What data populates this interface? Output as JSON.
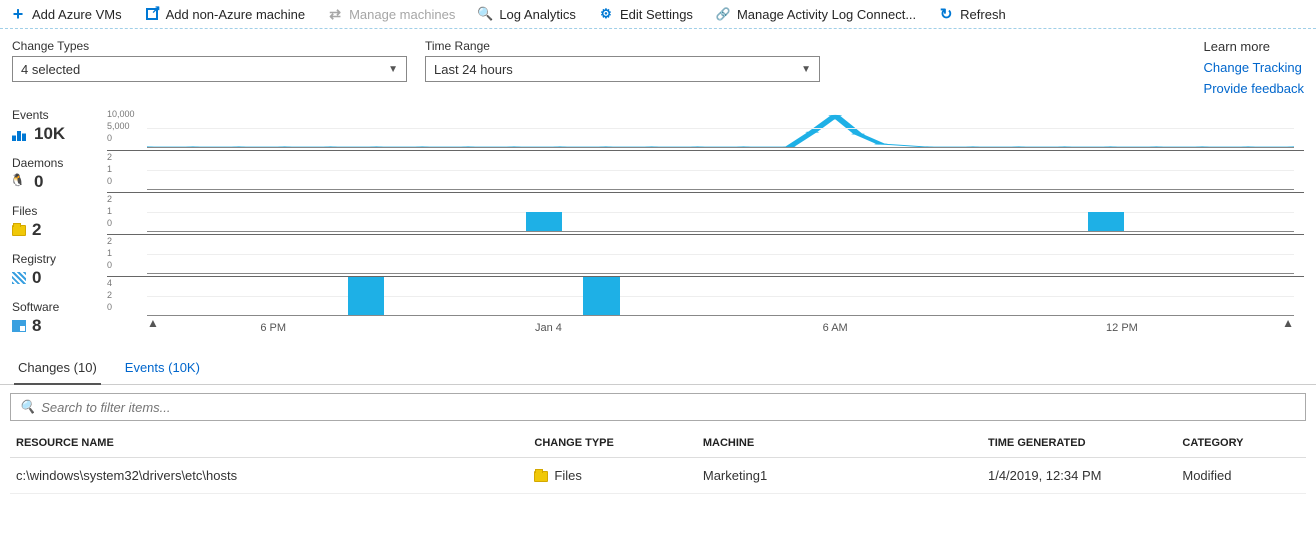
{
  "toolbar": {
    "add_vms": "Add Azure VMs",
    "add_non_azure": "Add non-Azure machine",
    "manage_machines": "Manage machines",
    "log_analytics": "Log Analytics",
    "edit_settings": "Edit Settings",
    "manage_activity": "Manage Activity Log Connect...",
    "refresh": "Refresh"
  },
  "filters": {
    "change_types_label": "Change Types",
    "change_types_value": "4 selected",
    "time_range_label": "Time Range",
    "time_range_value": "Last 24 hours"
  },
  "learn": {
    "title": "Learn more",
    "link1": "Change Tracking",
    "link2": "Provide feedback"
  },
  "metrics": {
    "events": {
      "label": "Events",
      "value": "10K"
    },
    "daemons": {
      "label": "Daemons",
      "value": "0"
    },
    "files": {
      "label": "Files",
      "value": "2"
    },
    "registry": {
      "label": "Registry",
      "value": "0"
    },
    "software": {
      "label": "Software",
      "value": "8"
    }
  },
  "tabs": {
    "changes": "Changes (10)",
    "events": "Events (10K)"
  },
  "search": {
    "placeholder": "Search to filter items..."
  },
  "table": {
    "headers": {
      "name": "RESOURCE NAME",
      "type": "CHANGE TYPE",
      "machine": "MACHINE",
      "time": "TIME GENERATED",
      "category": "CATEGORY"
    },
    "rows": [
      {
        "name": "c:\\windows\\system32\\drivers\\etc\\hosts",
        "type": "Files",
        "machine": "Marketing1",
        "time": "1/4/2019, 12:34 PM",
        "category": "Modified"
      }
    ]
  },
  "chart_data": [
    {
      "type": "line",
      "name": "Events",
      "yticks": [
        "10,000",
        "5,000",
        "0"
      ],
      "ylim": [
        0,
        10000
      ],
      "x_pct": [
        0,
        4,
        8,
        12,
        16,
        20,
        24,
        28,
        32,
        36,
        40,
        44,
        48,
        52,
        56,
        58,
        60,
        62,
        64,
        68,
        72,
        76,
        80,
        84,
        88,
        92,
        96,
        100
      ],
      "y": [
        0,
        0,
        0,
        0,
        0,
        0,
        0,
        0,
        0,
        0,
        0,
        0,
        0,
        0,
        0,
        4000,
        8500,
        3500,
        800,
        0,
        0,
        0,
        0,
        0,
        0,
        0,
        0,
        0
      ]
    },
    {
      "type": "bar",
      "name": "Daemons",
      "yticks": [
        "2",
        "1",
        "0"
      ],
      "ylim": [
        0,
        2
      ],
      "bars": []
    },
    {
      "type": "bar",
      "name": "Files",
      "yticks": [
        "2",
        "1",
        "0"
      ],
      "ylim": [
        0,
        2
      ],
      "bars": [
        {
          "x_pct": 33,
          "w_pct": 3.2,
          "value": 1
        },
        {
          "x_pct": 82,
          "w_pct": 3.2,
          "value": 1
        }
      ]
    },
    {
      "type": "bar",
      "name": "Registry",
      "yticks": [
        "2",
        "1",
        "0"
      ],
      "ylim": [
        0,
        2
      ],
      "bars": []
    },
    {
      "type": "bar",
      "name": "Software",
      "yticks": [
        "4",
        "2",
        "0"
      ],
      "ylim": [
        0,
        4
      ],
      "bars": [
        {
          "x_pct": 17.5,
          "w_pct": 3.2,
          "value": 4
        },
        {
          "x_pct": 38,
          "w_pct": 3.2,
          "value": 4
        }
      ]
    }
  ],
  "xaxis": {
    "ticks": [
      {
        "pos_pct": 11,
        "label": "6 PM"
      },
      {
        "pos_pct": 35,
        "label": "Jan 4"
      },
      {
        "pos_pct": 60,
        "label": "6 AM"
      },
      {
        "pos_pct": 85,
        "label": "12 PM"
      }
    ]
  }
}
